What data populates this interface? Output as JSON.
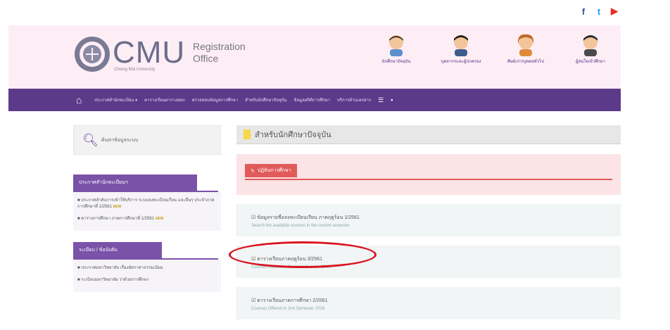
{
  "social": {
    "facebook": "f",
    "twitter": "t",
    "youtube": "▶"
  },
  "header": {
    "logo_text": "CMU",
    "logo_sub": "Chiang Mai University",
    "office_line1": "Registration",
    "office_line2": "Office",
    "avatars": [
      {
        "label": "นักศึกษาปัจจุบัน",
        "color": "#d98c52",
        "hair": "#3a2a1a"
      },
      {
        "label": "บุคลากรและผู้ปกครอง",
        "color": "#d98c52",
        "hair": "#2a1e15"
      },
      {
        "label": "ศิษย์เก่า/บุคคลทั่วไป",
        "color": "#d98c52",
        "hair": "#c06a2a"
      },
      {
        "label": "ผู้สนใจเข้าศึกษา",
        "color": "#d98c52",
        "hair": "#2a2a2a"
      }
    ]
  },
  "nav": {
    "items": [
      "ประกาศสำนักทะเบียน ▾",
      "ตารางเรียนตารางสอบ",
      "ตรวจสอบข้อมูลการศึกษา",
      "สำหรับนักศึกษาปัจจุบัน",
      "ข้อมูลสถิติการศึกษา",
      "บริการด้านเอกสาร"
    ],
    "extra": [
      "☰",
      "▪"
    ]
  },
  "sidebar": {
    "search_text": "ค้นหาข้อมูลระบบ",
    "section1_title": "ประกาศสำนักทะเบียนฯ",
    "section1_items": [
      "ประกาศลำดับการเข้าใช้บริการ ระบบลงทะเบียนเรียน และอื่นๆ ประจำภาคการศึกษาที่ 1/2561",
      "ตารางการศึกษา ภาคการศึกษาที่ 1/2561"
    ],
    "new_badge": "NEW",
    "section2_title": "ระเบียบ / ข้อบังคับ",
    "section2_items": [
      "ประกาศมหาวิทยาลัย เรื่องอัตราค่าธรรมเนียม",
      "ระเบียบมหาวิทยาลัย ว่าด้วยการศึกษา"
    ]
  },
  "main": {
    "title": "สำหรับนักศึกษาปัจจุบัน",
    "badge": "ปฏิทินการศึกษา",
    "cards": [
      {
        "title": "ข้อมูลรายชื่อลงทะเบียนเรียน ภาคฤดูร้อน 1/2561",
        "sub": "Search the available courses in the current semester"
      },
      {
        "title": "ตารางเรียนภาคฤดูร้อน 3/2561",
        "sub": "Courses Offered in Summer Session 2018"
      },
      {
        "title": "ตารางเรียนภาคการศึกษา 2/2561",
        "sub": "Courses Offered in 2nd Semester 2018"
      }
    ]
  },
  "colors": {
    "nav": "#5c3a8a",
    "header": "#fdeef6",
    "highlight": "#d8141f"
  }
}
